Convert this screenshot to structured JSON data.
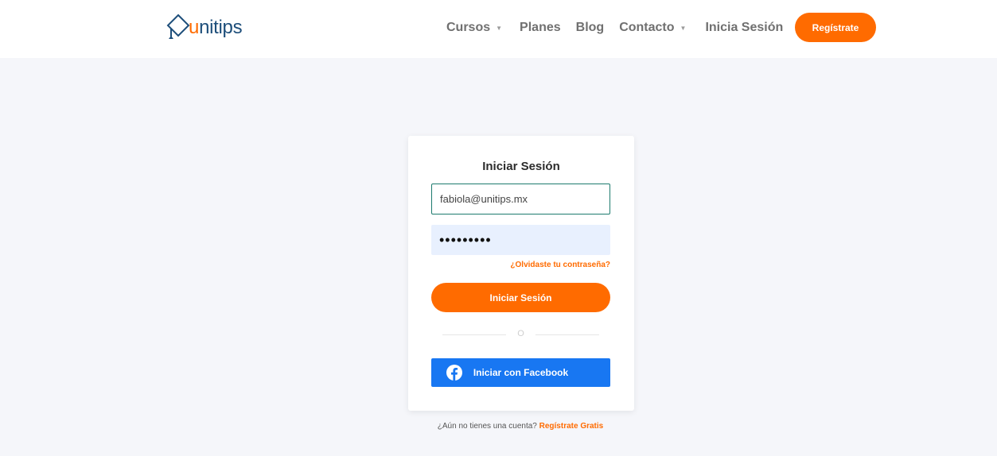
{
  "brand": {
    "logo_prefix": "u",
    "logo_rest": "nitips",
    "colors": {
      "accent": "#ff6b00",
      "logo_blue": "#1d4e7a",
      "facebook": "#1877f2"
    }
  },
  "nav": {
    "cursos": "Cursos",
    "planes": "Planes",
    "blog": "Blog",
    "contacto": "Contacto",
    "login": "Inicia Sesión",
    "register": "Regístrate",
    "caret_icon": "caret-down-icon"
  },
  "login_card": {
    "title": "Iniciar Sesión",
    "email_value": "fabiola@unitips.mx",
    "password_value": "•••••••••",
    "forgot": "¿Olvidaste tu contraseña?",
    "submit": "Iniciar Sesión",
    "divider": "O",
    "facebook": "Iniciar con Facebook",
    "facebook_icon": "facebook-icon"
  },
  "footer": {
    "prompt": "¿Aún no tienes una cuenta?",
    "link": "Regístrate Gratis"
  }
}
